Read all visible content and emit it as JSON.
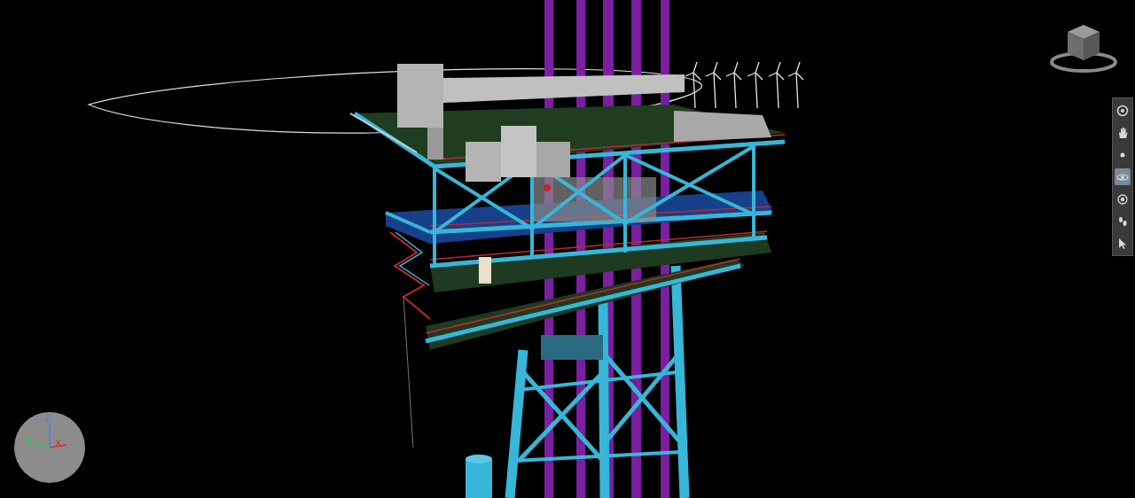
{
  "toolbar": {
    "tools": [
      {
        "kind": "wheel",
        "selected": false
      },
      {
        "kind": "pan",
        "selected": false
      },
      {
        "kind": "zoom",
        "selected": false
      },
      {
        "kind": "orbit",
        "selected": true
      },
      {
        "kind": "look",
        "selected": false
      },
      {
        "kind": "walk",
        "selected": false
      },
      {
        "kind": "select",
        "selected": false
      }
    ]
  },
  "axis_gizmo": {
    "axes": [
      {
        "label": "Z",
        "color": "#4a7dff"
      },
      {
        "label": "Y",
        "color": "#2ecc40"
      },
      {
        "label": "X",
        "color": "#e0302a"
      }
    ]
  }
}
